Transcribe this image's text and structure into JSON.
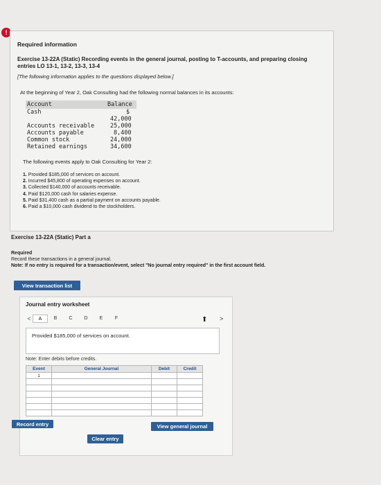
{
  "alert_badge": "!",
  "info": {
    "required_info": "Required information",
    "exercise_title": "Exercise 13-22A (Static) Recording events in the general journal, posting to T-accounts, and preparing closing entries LO 13-1, 13-2, 13-3, 13-4",
    "applies_note": "[The following information applies to the questions displayed below.]",
    "intro": "At the beginning of Year 2, Oak Consulting had the following normal balances in its accounts:",
    "balance_table": {
      "col_account": "Account",
      "col_balance": "Balance",
      "currency_symbol": "$",
      "rows": [
        {
          "account": "Cash",
          "balance": "42,000"
        },
        {
          "account": "Accounts receivable",
          "balance": "25,000"
        },
        {
          "account": "Accounts payable",
          "balance": "8,400"
        },
        {
          "account": "Common stock",
          "balance": "24,000"
        },
        {
          "account": "Retained earnings",
          "balance": "34,600"
        }
      ]
    },
    "events_title": "The following events apply to Oak Consulting for Year 2:",
    "events": [
      {
        "num": "1.",
        "text": "Provided $185,000 of services on account."
      },
      {
        "num": "2.",
        "text": "Incurred $45,800 of operating expenses on account."
      },
      {
        "num": "3.",
        "text": "Collected $140,000 of accounts receivable."
      },
      {
        "num": "4.",
        "text": "Paid $120,000 cash for salaries expense."
      },
      {
        "num": "5.",
        "text": "Paid $31,400 cash as a partial payment on accounts payable."
      },
      {
        "num": "6.",
        "text": "Paid a $10,000 cash dividend to the stockholders."
      }
    ]
  },
  "part": {
    "title": "Exercise 13-22A (Static) Part a",
    "required_label": "Required",
    "required_text": "Record these transactions in a general journal.",
    "note_label": "Note:",
    "note_text": "If no entry is required for a transaction/event, select \"No journal entry required\" in the first account field."
  },
  "buttons": {
    "view_transaction_list": "View transaction list",
    "record_entry": "Record entry",
    "clear_entry": "Clear entry",
    "view_general_journal": "View general journal"
  },
  "worksheet": {
    "title": "Journal entry worksheet",
    "prev_arrow": "<",
    "next_arrow": ">",
    "tabs": [
      "A",
      "B",
      "C",
      "D",
      "E",
      "F"
    ],
    "active_tab": "A",
    "prompt": "Provided $185,000 of services on account.",
    "debits_note": "Note: Enter debits before credits.",
    "columns": {
      "event": "Event",
      "general_journal": "General Journal",
      "debit": "Debit",
      "credit": "Credit"
    },
    "first_event": "1"
  },
  "colors": {
    "accent": "#2f5f97",
    "alert": "#c8102e"
  }
}
